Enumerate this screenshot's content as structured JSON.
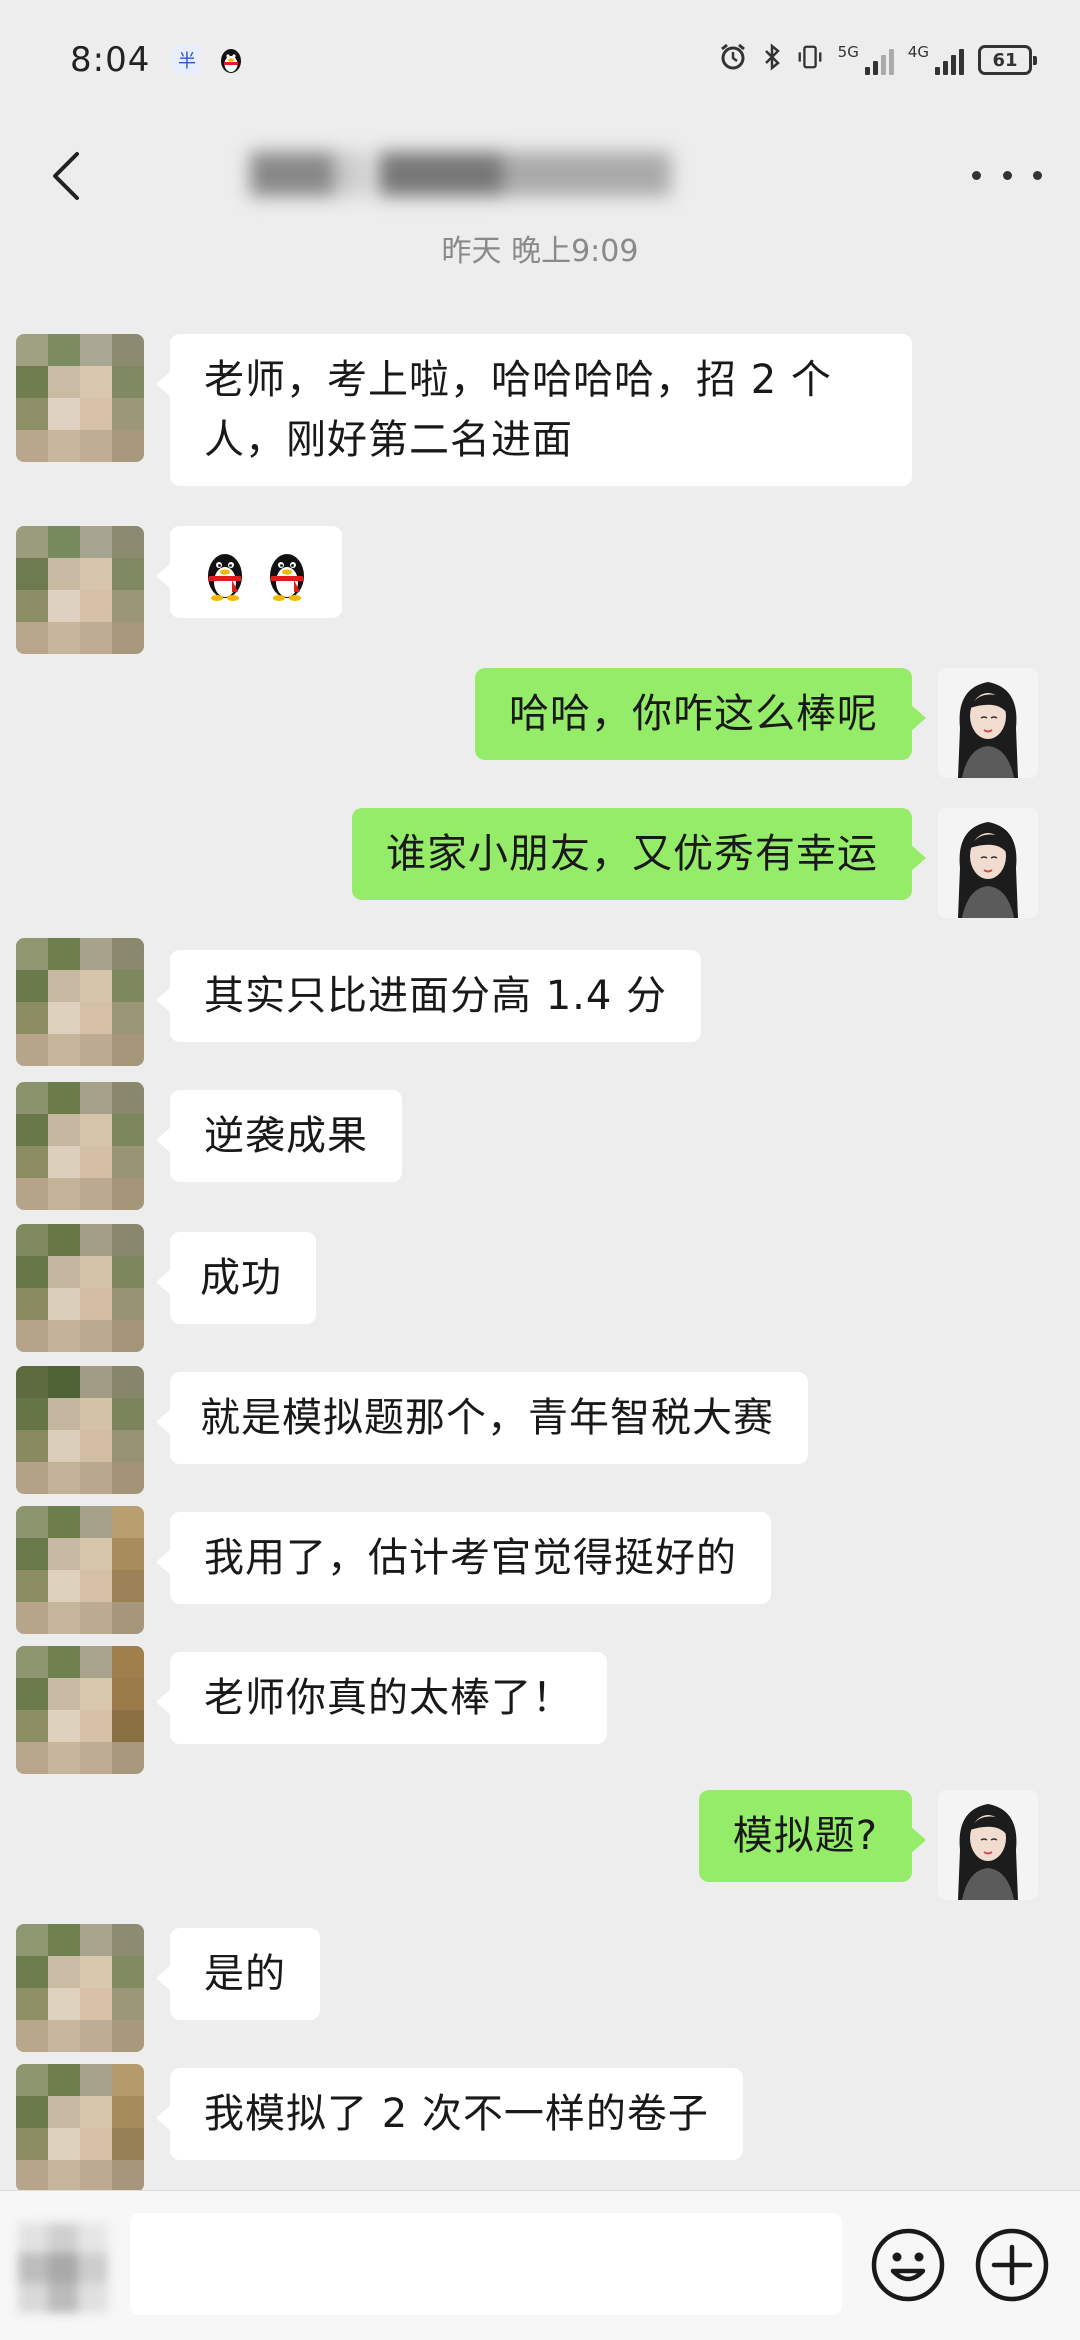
{
  "status_bar": {
    "time": "8:04",
    "app_icons": [
      "unicom-icon",
      "penguin-icon"
    ],
    "network_5g": "5G",
    "network_4g": "4G",
    "battery": "61"
  },
  "header": {
    "title": "████ ██████████"
  },
  "timestamp": "昨天 晚上9:09",
  "messages": [
    {
      "side": "in",
      "text": "老师，考上啦，哈哈哈哈，招 2 个人，刚好第二名进面"
    },
    {
      "side": "in",
      "text": "",
      "emoji": [
        "penguin-scarf-emoji",
        "penguin-scarf-emoji"
      ]
    },
    {
      "side": "out",
      "text": "哈哈，你咋这么棒呢"
    },
    {
      "side": "out",
      "text": "谁家小朋友，又优秀有幸运"
    },
    {
      "side": "in",
      "text": "其实只比进面分高 1.4 分"
    },
    {
      "side": "in",
      "text": "逆袭成果"
    },
    {
      "side": "in",
      "text": "成功"
    },
    {
      "side": "in",
      "text": "就是模拟题那个，青年智税大赛"
    },
    {
      "side": "in",
      "text": "我用了，估计考官觉得挺好的"
    },
    {
      "side": "in",
      "text": "老师你真的太棒了！"
    },
    {
      "side": "out",
      "text": "模拟题?"
    },
    {
      "side": "in",
      "text": "是的"
    },
    {
      "side": "in",
      "text": "我模拟了 2 次不一样的卷子"
    }
  ],
  "input_bar": {
    "placeholder": "",
    "emoji_button": "smiley-icon",
    "plus_button": "plus-circle-icon"
  },
  "colors": {
    "background": "#ededed",
    "outgoing_bubble": "#95ec69",
    "incoming_bubble": "#ffffff"
  }
}
